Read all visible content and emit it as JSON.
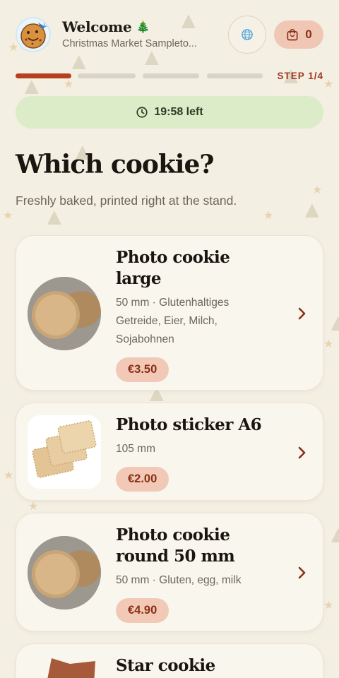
{
  "header": {
    "title": "Welcome",
    "title_emoji": "🎄",
    "subtitle": "Christmas Market Sampleto...",
    "avatar_icon": "cookie-mascot-icon",
    "language_icon": "globe-icon",
    "cart_icon": "shopping-bag-icon",
    "cart_count": "0"
  },
  "progress": {
    "label": "STEP 1/4",
    "current_step": 1,
    "total_steps": 4
  },
  "timer": {
    "icon": "clock-icon",
    "text": "19:58 left"
  },
  "main": {
    "heading": "Which cookie?",
    "lead": "Freshly baked, printed right at the stand."
  },
  "products": [
    {
      "title_lines": [
        "Photo cookie",
        "large"
      ],
      "meta_lines": [
        "50 mm · Glutenhaltiges",
        "Getreide, Eier, Milch,",
        "Sojabohnen"
      ],
      "price": "€3.50"
    },
    {
      "title_lines": [
        "Photo sticker A6"
      ],
      "meta_lines": [
        "105 mm"
      ],
      "price": "€2.00"
    },
    {
      "title_lines": [
        "Photo cookie",
        "round 50 mm"
      ],
      "meta_lines": [
        "50 mm · Gluten, egg, milk"
      ],
      "price": "€4.90"
    },
    {
      "title_lines": [
        "Star cookie"
      ],
      "meta_lines": [],
      "price": ""
    }
  ],
  "colors": {
    "accent": "#b5401e",
    "background": "#f4efe3",
    "timer_bg": "#dcebc8",
    "price_bg": "#f2c9b6"
  }
}
